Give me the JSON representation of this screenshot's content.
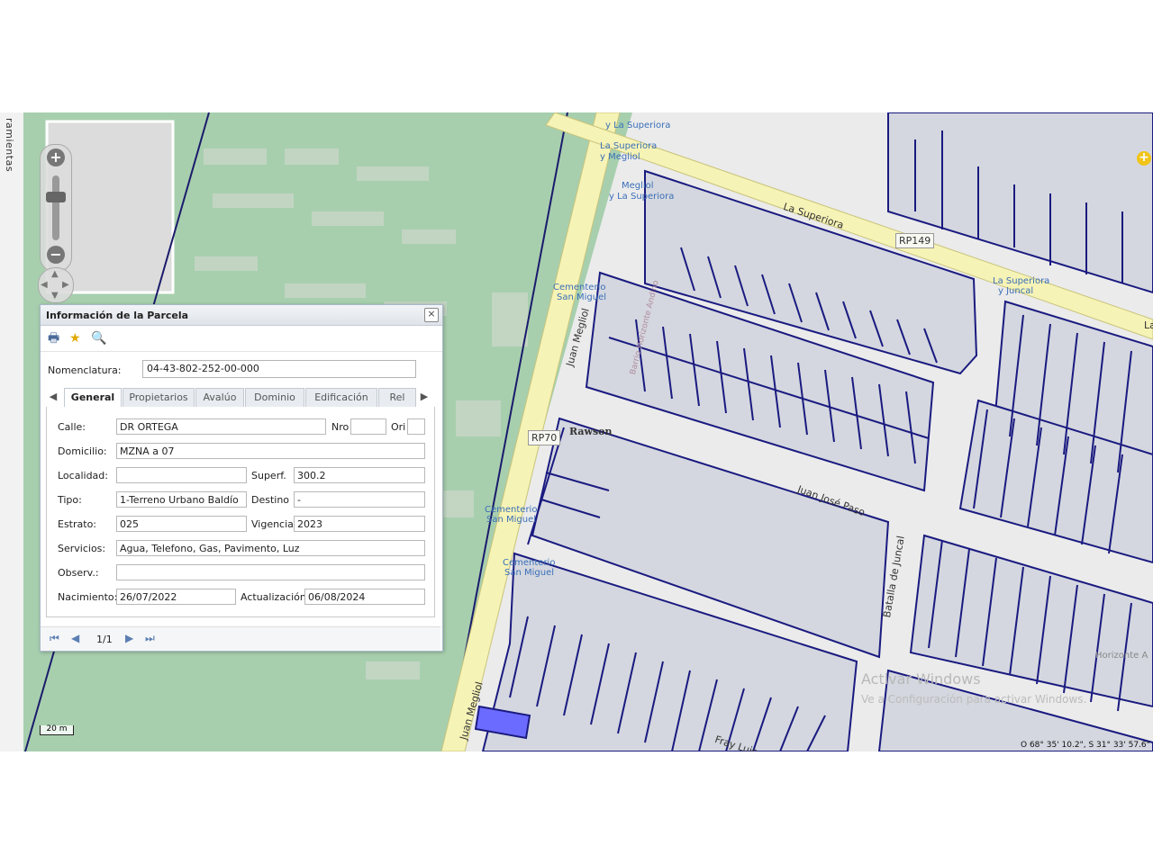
{
  "sidebar": {
    "vertical_label": "ramientas"
  },
  "map": {
    "labels": {
      "superiora_a": "y La Superiora",
      "superiora_b": "La Superiora",
      "superiora_c": "y Megliol",
      "megliol_stop": "Megliol",
      "megliol_stop2": "y La Superiora",
      "cementerio1": "Cementerio",
      "cementerio1b": "San Miguel",
      "cementerio2": "Cementerio",
      "cementerio2b": "San Miguel",
      "cementerio3": "Cementerio",
      "cementerio3b": "San Miguel",
      "la_superiora_road": "La Superiora",
      "rp149": "RP149",
      "rp70": "RP70",
      "rawson": "Rawson",
      "juan_megliol_1": "Juan Megliol",
      "juan_megliol_2": "Juan Megliol",
      "juan_jose_paso": "Juan José Paso",
      "batalla_juncal": "Batalla de Juncal",
      "fray_luis": "Fray Luis",
      "barrio": "Barrio Horizonte Andino",
      "juncal_stop": "La Superiora",
      "juncal_stop2": "y Juncal",
      "horizonte_a": "Horizonte A",
      "edge_la": "La",
      "watermark": "Activar Windows",
      "watermark2": "Ve a Configuración para activar Windows.",
      "scale": "20 m",
      "coords": "O 68° 35' 10.2\", S 31° 33' 57.6\""
    },
    "icons": {
      "zoom_in": "+",
      "zoom_out": "−",
      "pan": "pan-icon",
      "add": "+"
    }
  },
  "panel": {
    "title": "Información de la Parcela",
    "close": "×",
    "toolbar": {
      "print": "print-icon",
      "favorite": "star-icon",
      "search": "magnifier-icon"
    },
    "nomenclatura_label": "Nomenclatura:",
    "nomenclatura_value": "04-43-802-252-00-000",
    "tabs": [
      "General",
      "Propietarios",
      "Avalúo",
      "Dominio",
      "Edificación",
      "Rel"
    ],
    "active_tab": "General",
    "fields": {
      "calle_label": "Calle:",
      "calle_value": "DR ORTEGA",
      "nro_label": "Nro",
      "nro_value": "",
      "ori_label": "Ori",
      "ori_value": "",
      "domicilio_label": "Domicilio:",
      "domicilio_value": " MZNA a  07",
      "localidad_label": "Localidad:",
      "localidad_value": "",
      "superf_label": "Superf.",
      "superf_value": "300.2",
      "tipo_label": "Tipo:",
      "tipo_value": "1-Terreno Urbano Baldío",
      "destino_label": "Destino",
      "destino_value": "-",
      "estrato_label": "Estrato:",
      "estrato_value": "025",
      "vigencia_label": "Vigencia",
      "vigencia_value": "2023",
      "servicios_label": "Servicios:",
      "servicios_value": "Agua, Telefono, Gas, Pavimento, Luz",
      "observ_label": "Observ.:",
      "observ_value": "",
      "nacimiento_label": "Nacimiento:",
      "nacimiento_value": "26/07/2022",
      "actualizacion_label": "Actualización",
      "actualizacion_value": "06/08/2024"
    },
    "pager": {
      "count": "1/1",
      "first": "⏮",
      "prev": "◀",
      "next": "▶",
      "last": "⏭"
    }
  }
}
